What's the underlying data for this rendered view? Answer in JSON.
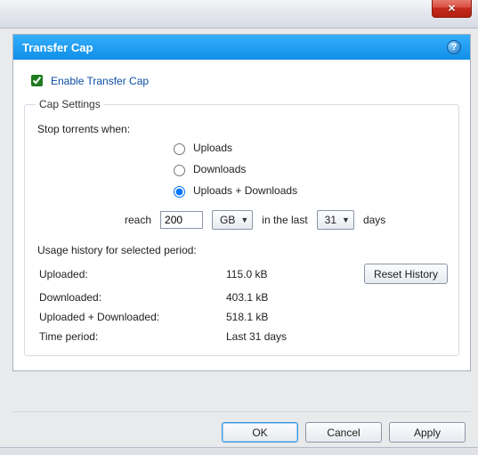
{
  "window": {
    "close_glyph": "✕"
  },
  "header": {
    "title": "Transfer Cap",
    "help_glyph": "?"
  },
  "enable": {
    "label": "Enable Transfer Cap",
    "checked": true
  },
  "cap_settings": {
    "legend": "Cap Settings",
    "stop_label": "Stop torrents when:",
    "radios": {
      "uploads": "Uploads",
      "downloads": "Downloads",
      "both": "Uploads + Downloads",
      "selected": "both"
    },
    "reach_label": "reach",
    "reach_value": "200",
    "reach_unit": "GB",
    "in_last_label": "in the last",
    "period_value": "31",
    "days_label": "days",
    "history_label": "Usage history for selected period:",
    "rows": {
      "uploaded_label": "Uploaded:",
      "uploaded_value": "115.0 kB",
      "downloaded_label": "Downloaded:",
      "downloaded_value": "403.1 kB",
      "both_label": "Uploaded + Downloaded:",
      "both_value": "518.1 kB",
      "period_label": "Time period:",
      "period_value": "Last 31 days"
    },
    "reset_label": "Reset History"
  },
  "buttons": {
    "ok": "OK",
    "cancel": "Cancel",
    "apply": "Apply"
  }
}
